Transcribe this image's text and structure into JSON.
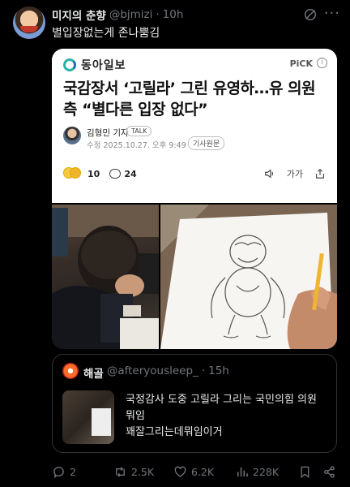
{
  "tweet": {
    "author_name": "미지의 춘향",
    "author_handle": "@bjmizi",
    "separator": "·",
    "time": "10h",
    "text": "별입장없는게 존나뿜김",
    "grok_icon": "slash-circle-icon",
    "more_icon": "more-dots-icon"
  },
  "news_card": {
    "brand": "동아일보",
    "pick_label": "PiCK",
    "info_icon": "info-icon",
    "headline_line1": "국감장서 ‘고릴라’ 그린 유영하…유 의원",
    "headline_line2": "측 “별다른 입장 없다”",
    "reporter": "김형민 기자",
    "talk_label": "TALK",
    "date": "수정 2025.10.27. 오후 9:49",
    "original_label": "기사원문",
    "reaction_count": "10",
    "comment_count": "24",
    "font_tool_label": "가가"
  },
  "quote": {
    "author_name": "해골",
    "author_handle": "@afteryousleep_",
    "separator": "·",
    "time": "15h",
    "line1": "국정감사 도중 고릴라 그리는 국민의힘 의원",
    "line2": "뭐임",
    "line3": "꽤잘그리는데뭐임이거"
  },
  "actions": {
    "reply_count": "2",
    "retweet_count": "2.5K",
    "like_count": "6.2K",
    "view_count": "228K"
  },
  "colors": {
    "background": "#000000",
    "text": "#e7e9ea",
    "muted": "#71767b",
    "border": "#2f3336"
  }
}
